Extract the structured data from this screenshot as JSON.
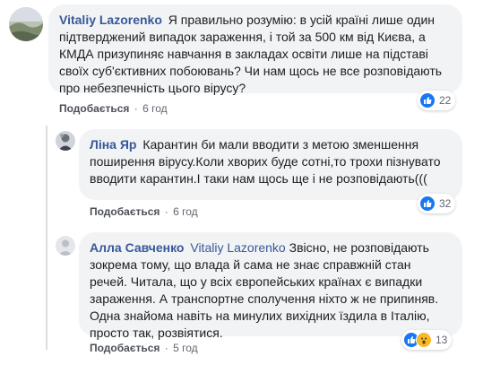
{
  "comments": [
    {
      "author": "Vitaliy Lazorenko",
      "text": "Я правильно розумію: в усій країні лише один підтверджений випадок зараження, і той за 500 км від Києва, а КМДА призупиняє навчання в закладах освіти лише на підставі своїх суб'єктивних побоювань? Чи нам щось не все розповідають про небезпечність цього вірусу?",
      "like_label": "Подобається",
      "time": "6 год",
      "reaction_count": "22"
    },
    {
      "author": "Ліна Яр",
      "text": "Карантин би мали вводити з метою зменшення поширення вірусу.Коли хворих буде сотні,то трохи пізнувато вводити карантин.І таки нам щось ще і не розповідають(((",
      "like_label": "Подобається",
      "time": "6 год",
      "reaction_count": "32"
    },
    {
      "author": "Алла Савченко",
      "mention": "Vitaliy Lazorenko",
      "text": "Звісно, не розповідають зокрема тому, що влада й сама не знає справжній стан речей. Читала, що у всіх європейських країнах є випадки зараження. А транспортне сполучення ніхто ж не припиняв. Одна знайома навіть на минулих вихідних їздила в Італію, просто так, розвіятися.",
      "like_label": "Подобається",
      "time": "5 год",
      "reaction_count": "13"
    }
  ],
  "separator": "·",
  "colors": {
    "link": "#385898",
    "bubble": "#f2f3f5",
    "like_blue": "#1877f2",
    "wow_yellow": "#f7b928"
  }
}
